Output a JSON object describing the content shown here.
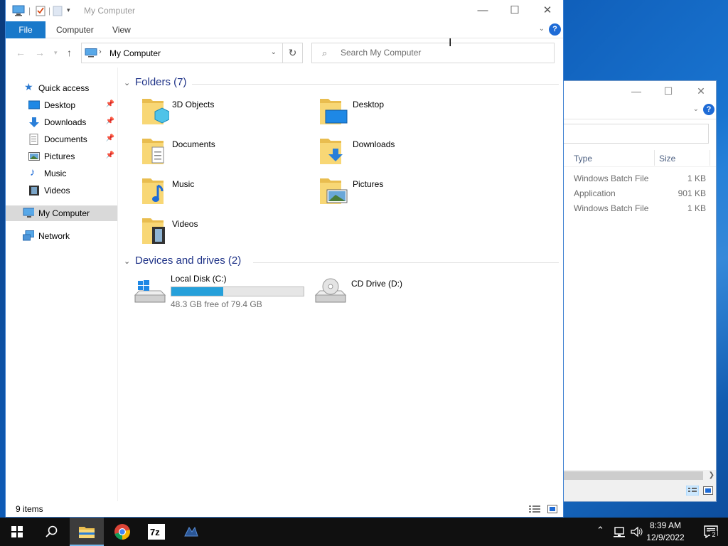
{
  "desktop": {},
  "background_window": {
    "columns": {
      "type": "Type",
      "size": "Size"
    },
    "rows": [
      {
        "type": "Windows Batch File",
        "size": "1 KB"
      },
      {
        "type": "Application",
        "size": "901 KB"
      },
      {
        "type": "Windows Batch File",
        "size": "1 KB"
      }
    ]
  },
  "window": {
    "title": "My Computer",
    "controls": {
      "minimize": "—",
      "maximize": "☐",
      "close": "✕"
    }
  },
  "ribbon": {
    "tabs": [
      "File",
      "Computer",
      "View"
    ],
    "help": "?"
  },
  "address": {
    "location": "My Computer",
    "search_placeholder": "Search My Computer"
  },
  "nav_pane": {
    "quick_access": "Quick access",
    "items": [
      {
        "label": "Desktop",
        "pinned": true
      },
      {
        "label": "Downloads",
        "pinned": true
      },
      {
        "label": "Documents",
        "pinned": true
      },
      {
        "label": "Pictures",
        "pinned": true
      },
      {
        "label": "Music",
        "pinned": false
      },
      {
        "label": "Videos",
        "pinned": false
      }
    ],
    "this_pc": "My Computer",
    "network": "Network"
  },
  "content": {
    "folders_header": "Folders (7)",
    "folders": [
      "3D Objects",
      "Desktop",
      "Documents",
      "Downloads",
      "Music",
      "Pictures",
      "Videos"
    ],
    "devices_header": "Devices and drives (2)",
    "drives": [
      {
        "name": "Local Disk (C:)",
        "free_text": "48.3 GB free of 79.4 GB",
        "used_fraction": 0.39
      },
      {
        "name": "CD Drive (D:)"
      }
    ]
  },
  "statusbar": {
    "item_count": "9 items"
  },
  "taskbar": {
    "clock_time": "8:39 AM",
    "clock_date": "12/9/2022",
    "notification_count": "2",
    "apps": [
      "start",
      "search",
      "file-explorer",
      "chrome",
      "7-zip",
      "other-app"
    ]
  },
  "colors": {
    "accent": "#1979ca",
    "selection": "#d9d9d9",
    "group_header": "#1e3287",
    "drive_bar": "#26a0da"
  }
}
